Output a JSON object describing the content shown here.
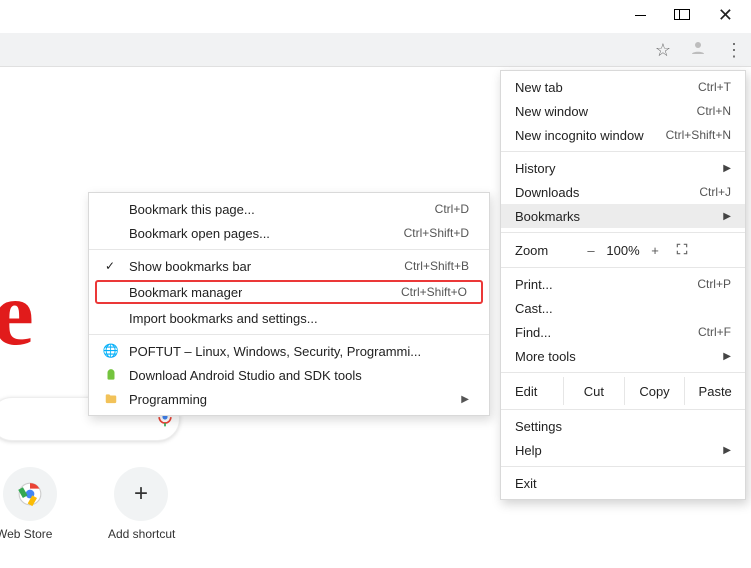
{
  "window_controls": {
    "minimize": "–",
    "maximize": "❐",
    "close": "✕"
  },
  "toolbar": {
    "star_icon": "☆",
    "profile_icon": "●",
    "menu_icon": "⋮"
  },
  "page_bg": {
    "big_letter": "e",
    "mic_icon": "mic"
  },
  "tiles": {
    "webstore": {
      "label": "Web Store"
    },
    "addshortcut": {
      "label": "Add shortcut",
      "icon": "+"
    }
  },
  "main_menu": {
    "new_tab": {
      "label": "New tab",
      "shortcut": "Ctrl+T"
    },
    "new_window": {
      "label": "New window",
      "shortcut": "Ctrl+N"
    },
    "new_incognito": {
      "label": "New incognito window",
      "shortcut": "Ctrl+Shift+N"
    },
    "history": {
      "label": "History"
    },
    "downloads": {
      "label": "Downloads",
      "shortcut": "Ctrl+J"
    },
    "bookmarks": {
      "label": "Bookmarks"
    },
    "zoom": {
      "label": "Zoom",
      "minus": "–",
      "pct": "100%",
      "plus": "+",
      "full": "⛶"
    },
    "print": {
      "label": "Print...",
      "shortcut": "Ctrl+P"
    },
    "cast": {
      "label": "Cast..."
    },
    "find": {
      "label": "Find...",
      "shortcut": "Ctrl+F"
    },
    "more_tools": {
      "label": "More tools"
    },
    "edit": {
      "label": "Edit",
      "cut": "Cut",
      "copy": "Copy",
      "paste": "Paste"
    },
    "settings": {
      "label": "Settings"
    },
    "help": {
      "label": "Help"
    },
    "exit": {
      "label": "Exit"
    }
  },
  "bookmarks_submenu": {
    "bookmark_page": {
      "label": "Bookmark this page...",
      "shortcut": "Ctrl+D"
    },
    "bookmark_open": {
      "label": "Bookmark open pages...",
      "shortcut": "Ctrl+Shift+D"
    },
    "show_bar": {
      "label": "Show bookmarks bar",
      "shortcut": "Ctrl+Shift+B"
    },
    "manager": {
      "label": "Bookmark manager",
      "shortcut": "Ctrl+Shift+O"
    },
    "import": {
      "label": "Import bookmarks and settings..."
    },
    "bm1": {
      "label": "POFTUT – Linux, Windows, Security, Programmi..."
    },
    "bm2": {
      "label": "Download Android Studio and SDK tools"
    },
    "bm3": {
      "label": "Programming"
    }
  }
}
